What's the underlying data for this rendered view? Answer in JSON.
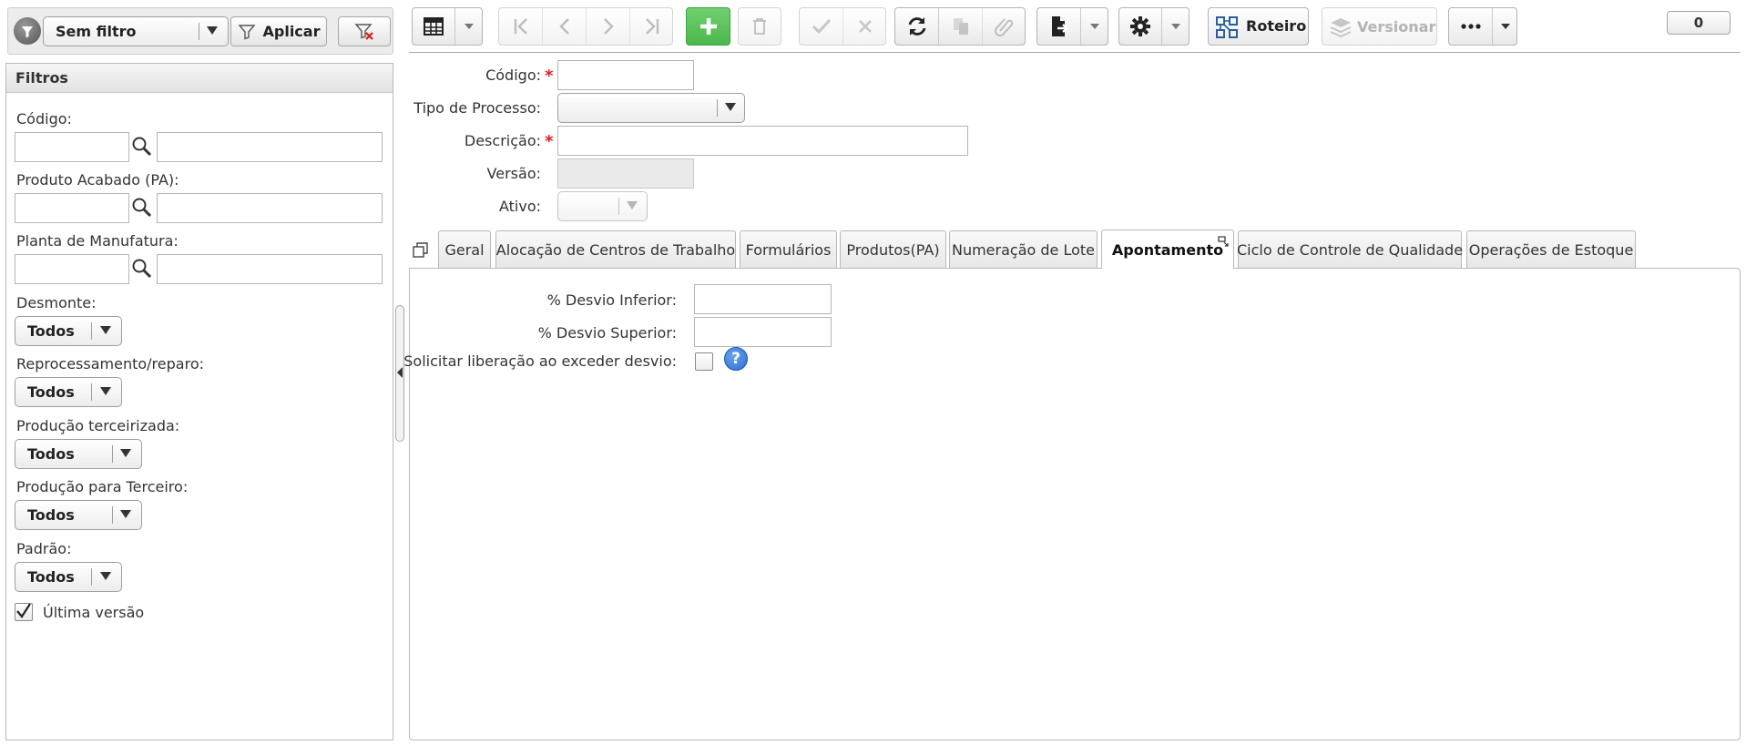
{
  "left_top": {
    "filter_select_value": "Sem filtro",
    "apply_label": "Aplicar"
  },
  "filters": {
    "title": "Filtros",
    "codigo_label": "Código:",
    "produto_label": "Produto Acabado (PA):",
    "planta_label": "Planta de Manufatura:",
    "desmonte_label": "Desmonte:",
    "desmonte_value": "Todos",
    "reprocessamento_label": "Reprocessamento/reparo:",
    "reprocessamento_value": "Todos",
    "prod_terceirizada_label": "Produção terceirizada:",
    "prod_terceirizada_value": "Todos",
    "prod_terceiro_label": "Produção para Terceiro:",
    "prod_terceiro_value": "Todos",
    "padrao_label": "Padrão:",
    "padrao_value": "Todos",
    "ultima_versao_label": "Última versão",
    "ultima_versao_checked": true
  },
  "toolbar": {
    "roteiro_label": "Roteiro",
    "versionar_label": "Versionar",
    "counter": "0"
  },
  "form": {
    "codigo_label": "Código:",
    "tipo_label": "Tipo de Processo:",
    "descricao_label": "Descrição:",
    "versao_label": "Versão:",
    "ativo_label": "Ativo:"
  },
  "tabs": [
    {
      "label": "Geral"
    },
    {
      "label": "Alocação de Centros de Trabalho"
    },
    {
      "label": "Formulários"
    },
    {
      "label": "Produtos(PA)"
    },
    {
      "label": "Numeração de Lote"
    },
    {
      "label": "Apontamento",
      "active": true
    },
    {
      "label": "Ciclo de Controle de Qualidade"
    },
    {
      "label": "Operações de Estoque"
    }
  ],
  "apontamento": {
    "desvio_inferior_label": "% Desvio Inferior:",
    "desvio_superior_label": "% Desvio Superior:",
    "solicitar_label": "Solicitar liberação ao exceder desvio:"
  },
  "colors": {
    "accent_green": "#5cc35c",
    "help_blue": "#2a6fd1",
    "required_red": "#e02020"
  }
}
